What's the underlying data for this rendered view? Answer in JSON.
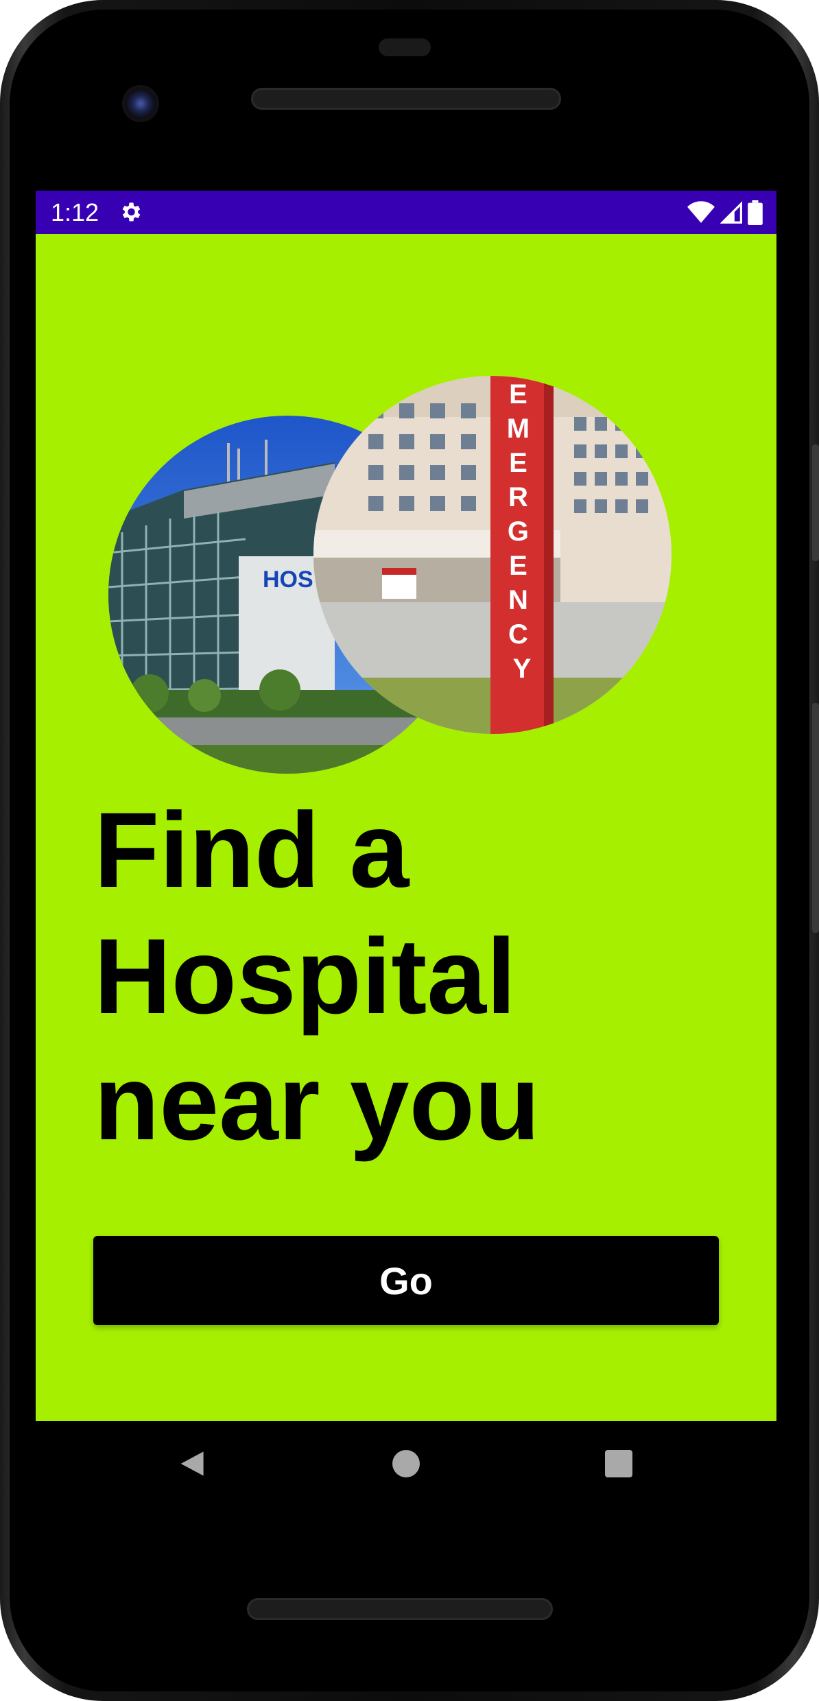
{
  "status_bar": {
    "time": "1:12",
    "color": "#3700b3",
    "icons": [
      "settings-gear-icon",
      "wifi-icon",
      "cell-signal-icon",
      "battery-icon"
    ]
  },
  "screen": {
    "background_color": "#a6ef00",
    "images": [
      {
        "name": "hospital-building-image",
        "sign_text": "HOS"
      },
      {
        "name": "emergency-entrance-image",
        "sign_text": "EMERGENCY"
      }
    ],
    "headline": {
      "line1": "Find a",
      "line2": "Hospital",
      "line3": "near you"
    },
    "go_button": {
      "label": "Go"
    }
  },
  "navigation_bar": {
    "buttons": [
      "back-icon",
      "home-icon",
      "recents-icon"
    ]
  }
}
